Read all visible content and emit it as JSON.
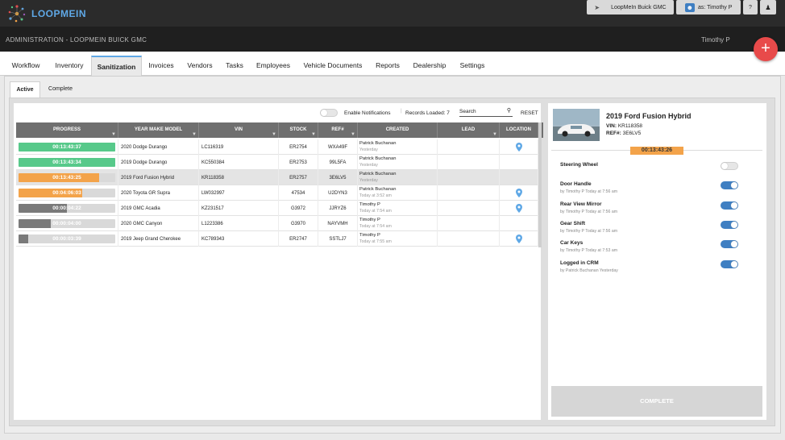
{
  "topbar": {
    "logo_text": "LOOPMEIN",
    "dealer_button": "LoopMeIn Buick GMC",
    "as_user_button": "as: Timothy P",
    "help_button": "?",
    "colors": {
      "bar": "#2b2b2b",
      "accent": "#5fa8e6"
    }
  },
  "admin": {
    "title": "ADMINISTRATION - LOOPMEIN BUICK GMC",
    "user": "Timothy P",
    "add_button": "+"
  },
  "nav": {
    "tabs": [
      "Workflow",
      "Inventory",
      "Sanitization",
      "Invoices",
      "Vendors",
      "Tasks",
      "Employees",
      "Vehicle Documents",
      "Reports",
      "Dealership",
      "Settings"
    ],
    "active": "Sanitization"
  },
  "subtabs": {
    "active": "Active",
    "complete": "Complete"
  },
  "toolbar": {
    "notifications_label": "Enable Notifications",
    "notifications_on": false,
    "records_loaded": "Records Loaded: 7",
    "search_placeholder": "Search",
    "reset_label": "RESET"
  },
  "table": {
    "headers": [
      "PROGRESS",
      "YEAR MAKE MODEL",
      "VIN",
      "STOCK",
      "REF#",
      "CREATED",
      "LEAD",
      "LOCATION"
    ],
    "rows": [
      {
        "timer": "00:13:43:37",
        "progress": 1.0,
        "color": "#57c98a",
        "ymm": "2020 Dodge Durango",
        "vin": "LC116319",
        "stock": "ER2754",
        "ref": "WXA49F",
        "created_by": "Patrick Buchanan",
        "created_when": "Yesterday",
        "lead": "",
        "location": true,
        "selected": false
      },
      {
        "timer": "00:13:43:34",
        "progress": 1.0,
        "color": "#57c98a",
        "ymm": "2019 Dodge Durango",
        "vin": "KC550384",
        "stock": "ER2753",
        "ref": "99L5FA",
        "created_by": "Patrick Buchanan",
        "created_when": "Yesterday",
        "lead": "",
        "location": false,
        "selected": false
      },
      {
        "timer": "00:13:43:25",
        "progress": 0.83,
        "color": "#f3a34a",
        "ymm": "2019 Ford Fusion Hybrid",
        "vin": "KR118358",
        "stock": "ER2757",
        "ref": "3E6LV5",
        "created_by": "Patrick Buchanan",
        "created_when": "Yesterday",
        "lead": "",
        "location": false,
        "selected": true
      },
      {
        "timer": "00:04:06:03",
        "progress": 0.66,
        "color": "#f3a34a",
        "ymm": "2020 Toyota GR Supra",
        "vin": "LW032997",
        "stock": "47534",
        "ref": "U2DYN3",
        "created_by": "Patrick Buchanan",
        "created_when": "Today at 3:52 am",
        "lead": "",
        "location": true,
        "selected": false
      },
      {
        "timer": "00:00:04:22",
        "progress": 0.5,
        "color": "#7a7a7a",
        "ymm": "2019 GMC Acadia",
        "vin": "KZ231517",
        "stock": "G3972",
        "ref": "JJRYZ6",
        "created_by": "Timothy P",
        "created_when": "Today at 7:54 am",
        "lead": "",
        "location": true,
        "selected": false
      },
      {
        "timer": "00:00:04:00",
        "progress": 0.33,
        "color": "#7a7a7a",
        "ymm": "2020 GMC Canyon",
        "vin": "L1223386",
        "stock": "G3970",
        "ref": "NAYVMH",
        "created_by": "Timothy P",
        "created_when": "Today at 7:54 am",
        "lead": "",
        "location": false,
        "selected": false
      },
      {
        "timer": "00:00:03:39",
        "progress": 0.1,
        "color": "#7a7a7a",
        "ymm": "2019 Jeep Grand Cherokee",
        "vin": "KC789343",
        "stock": "ER2747",
        "ref": "SSTLJ7",
        "created_by": "Timothy P",
        "created_when": "Today at 7:55 am",
        "lead": "",
        "location": true,
        "selected": false
      }
    ]
  },
  "detail": {
    "title": "2019 Ford Fusion Hybrid",
    "vin_label": "VIN:",
    "vin": "KR118358",
    "ref_label": "REF#:",
    "ref": "3E6LV5",
    "timer": "00:13:43:26",
    "checklist": [
      {
        "label": "Steering Wheel",
        "sub": "",
        "on": false
      },
      {
        "label": "Door Handle",
        "sub": "by Timothy P Today at 7:56 am",
        "on": true
      },
      {
        "label": "Rear View Mirror",
        "sub": "by Timothy P Today at 7:56 am",
        "on": true
      },
      {
        "label": "Gear Shift",
        "sub": "by Timothy P Today at 7:56 am",
        "on": true
      },
      {
        "label": "Car Keys",
        "sub": "by Timothy P Today at 7:53 am",
        "on": true
      },
      {
        "label": "Logged in CRM",
        "sub": "by Patrick Buchanan Yesterday",
        "on": true
      }
    ],
    "complete_label": "COMPLETE"
  }
}
